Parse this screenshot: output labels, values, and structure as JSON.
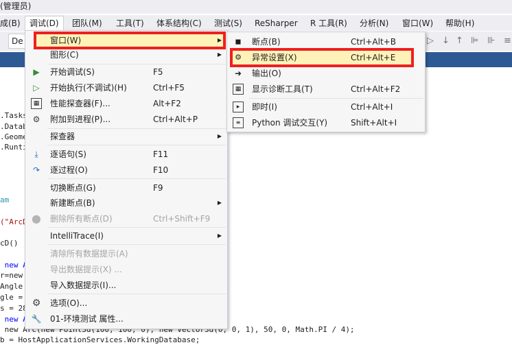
{
  "window": {
    "title": "(管理员)"
  },
  "menubar": {
    "items": [
      {
        "label": "成(B)"
      },
      {
        "label": "调试(D)"
      },
      {
        "label": "团队(M)"
      },
      {
        "label": "工具(T)"
      },
      {
        "label": "体系结构(C)"
      },
      {
        "label": "测试(S)"
      },
      {
        "label": "ReSharper"
      },
      {
        "label": "R 工具(R)"
      },
      {
        "label": "分析(N)"
      },
      {
        "label": "窗口(W)"
      },
      {
        "label": "帮助(H)"
      }
    ]
  },
  "toolbar": {
    "config_value": "De"
  },
  "debug_menu": {
    "items": [
      {
        "label": "窗口(W)",
        "shortcut": "",
        "submenu": true,
        "icon": ""
      },
      {
        "label": "图形(C)",
        "shortcut": "",
        "submenu": true,
        "icon": ""
      },
      {
        "label": "开始调试(S)",
        "shortcut": "F5",
        "icon": "play-icon"
      },
      {
        "label": "开始执行(不调试)(H)",
        "shortcut": "Ctrl+F5",
        "icon": "play-outline-icon"
      },
      {
        "label": "性能探查器(F)...",
        "shortcut": "Alt+F2",
        "icon": "chart-icon"
      },
      {
        "label": "附加到进程(P)...",
        "shortcut": "Ctrl+Alt+P",
        "icon": "gears-icon"
      },
      {
        "label": "探查器",
        "shortcut": "",
        "submenu": true,
        "icon": ""
      },
      {
        "label": "逐语句(S)",
        "shortcut": "F11",
        "icon": "step-into-icon"
      },
      {
        "label": "逐过程(O)",
        "shortcut": "F10",
        "icon": "step-over-icon"
      },
      {
        "label": "切换断点(G)",
        "shortcut": "F9",
        "icon": ""
      },
      {
        "label": "新建断点(B)",
        "shortcut": "",
        "submenu": true,
        "icon": ""
      },
      {
        "label": "删除所有断点(D)",
        "shortcut": "Ctrl+Shift+F9",
        "disabled": true,
        "icon": "delete-breakpoints-icon"
      },
      {
        "label": "IntelliTrace(I)",
        "shortcut": "",
        "submenu": true,
        "icon": ""
      },
      {
        "label": "清除所有数据提示(A)",
        "shortcut": "",
        "disabled": true,
        "icon": ""
      },
      {
        "label": "导出数据提示(X) ...",
        "shortcut": "",
        "disabled": true,
        "icon": ""
      },
      {
        "label": "导入数据提示(I)...",
        "shortcut": "",
        "icon": ""
      },
      {
        "label": "选项(O)...",
        "shortcut": "",
        "icon": "gear-icon"
      },
      {
        "label": "01-环境测试 属性...",
        "shortcut": "",
        "icon": "wrench-icon"
      }
    ]
  },
  "window_submenu": {
    "items": [
      {
        "label": "断点(B)",
        "shortcut": "Ctrl+Alt+B",
        "icon": "breakpoint-icon"
      },
      {
        "label": "异常设置(X)",
        "shortcut": "Ctrl+Alt+E",
        "icon": "exception-icon",
        "highlighted": true
      },
      {
        "label": "输出(O)",
        "shortcut": "",
        "icon": "output-icon"
      },
      {
        "label": "显示诊断工具(T)",
        "shortcut": "Ctrl+Alt+F2",
        "icon": "diagnostics-icon"
      },
      {
        "label": "即时(I)",
        "shortcut": "Ctrl+Alt+I",
        "icon": "immediate-icon"
      },
      {
        "label": "Python 调试交互(Y)",
        "shortcut": "Shift+Alt+I",
        "icon": "python-icon"
      }
    ]
  },
  "code": {
    "lines": [
      ".Tasks",
      ".Datab",
      ".Geome",
      ".Runti",
      "am",
      "(\"ArcD",
      "cD()",
      " new A",
      "r=new",
      "Angle",
      "gle =",
      "s = 28",
      " new A",
      " new Arc(new Point3d(100, 100, 0), new Vector3d(0, 0, 1), 50, 0, Math.PI / 4);",
      "b = HostApplicationServices.WorkingDatabase;"
    ]
  },
  "colors": {
    "highlight_border": "#ef1f1f",
    "highlight_fill": "#fff2b8",
    "tab_strip": "#2d5a94"
  }
}
